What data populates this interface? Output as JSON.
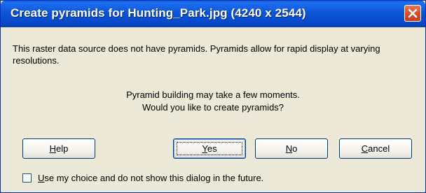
{
  "window": {
    "title": "Create pyramids for Hunting_Park.jpg (4240 x 2544)",
    "close_icon": "close-icon"
  },
  "message": {
    "intro": "This raster data source does not have pyramids. Pyramids allow for rapid display at varying resolutions.",
    "line1": "Pyramid building may take a few moments.",
    "line2": "Would you like to create pyramids?"
  },
  "buttons": {
    "help": {
      "mnemonic": "H",
      "rest": "elp"
    },
    "yes": {
      "mnemonic": "Y",
      "rest": "es"
    },
    "no": {
      "mnemonic": "N",
      "rest": "o"
    },
    "cancel": {
      "mnemonic": "C",
      "rest": "ancel"
    }
  },
  "checkbox": {
    "checked": false,
    "label_mnemonic": "U",
    "label_rest": "se my choice and do not show this dialog in the future."
  },
  "colors": {
    "titlebar": "#0c55d8",
    "dialog_bg": "#ece9d8",
    "close_button": "#d8502c"
  }
}
